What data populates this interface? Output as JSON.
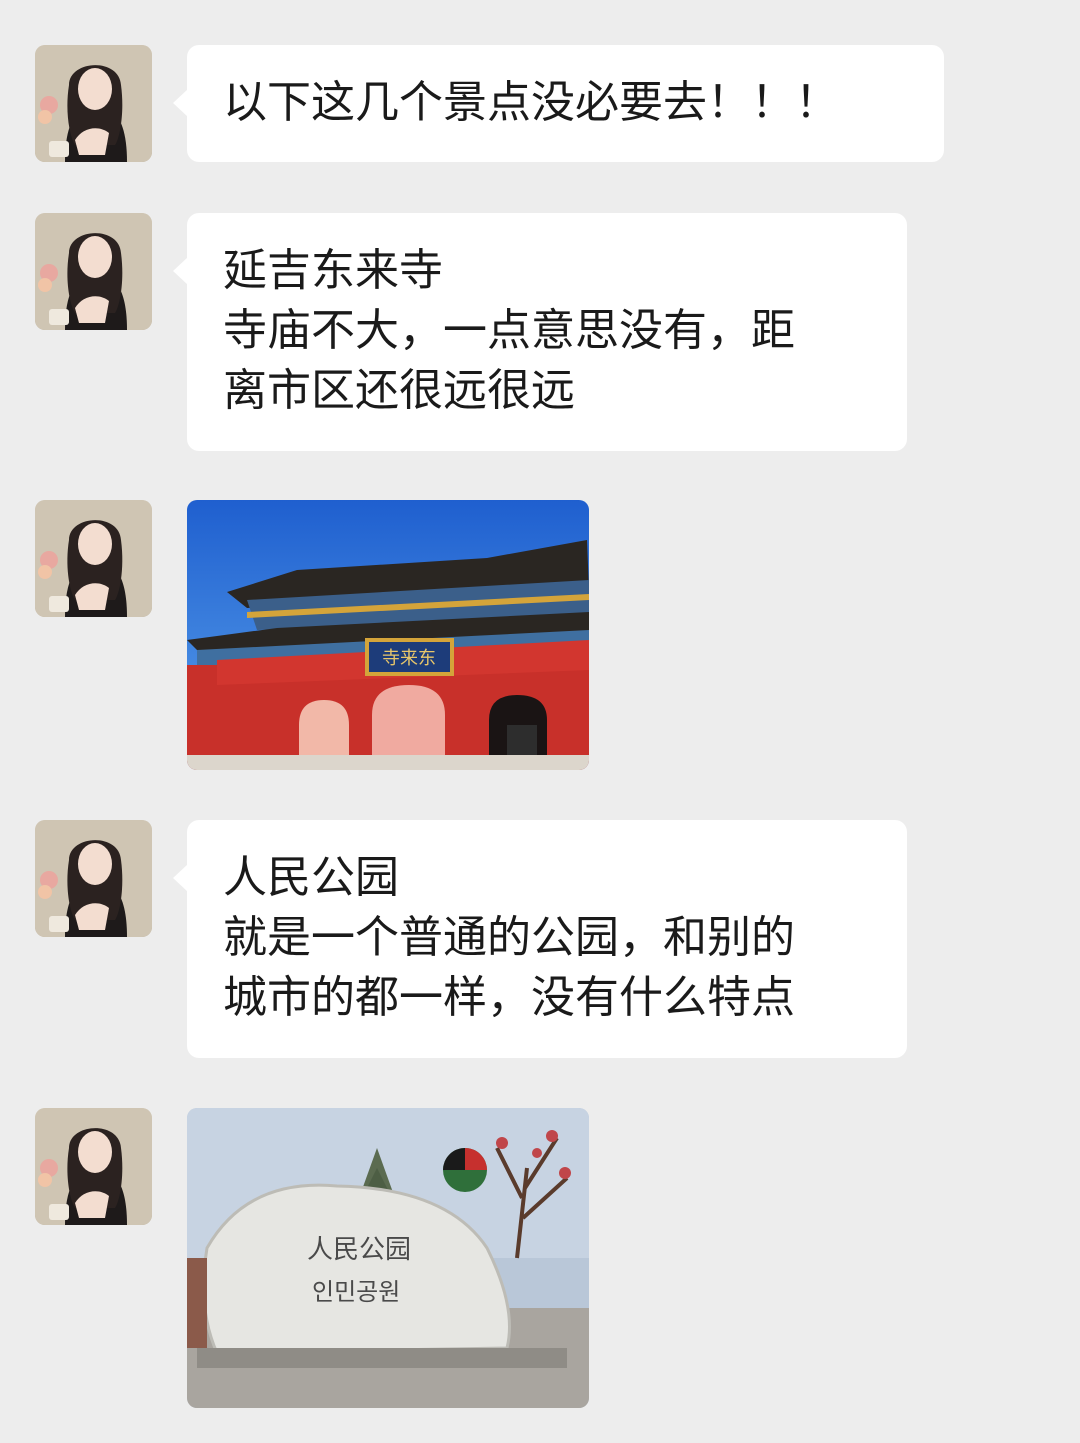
{
  "messages": [
    {
      "type": "text",
      "lines": [
        "以下这几个景点没必要去！！！"
      ]
    },
    {
      "type": "text",
      "lines": [
        "延吉东来寺",
        "寺庙不大，一点意思没有，距",
        "离市区还很远很远"
      ]
    },
    {
      "type": "image",
      "icon": "temple-gate-photo",
      "sign_text": "寺来东"
    },
    {
      "type": "text",
      "lines": [
        "人民公园",
        "就是一个普通的公园，和别的",
        "城市的都一样，没有什么特点"
      ]
    },
    {
      "type": "image",
      "icon": "park-stone-photo",
      "stone_text": [
        "人民公园",
        "인민공원"
      ]
    }
  ],
  "colors": {
    "background": "#ededed",
    "bubble": "#ffffff",
    "text": "#1a1a1a"
  }
}
